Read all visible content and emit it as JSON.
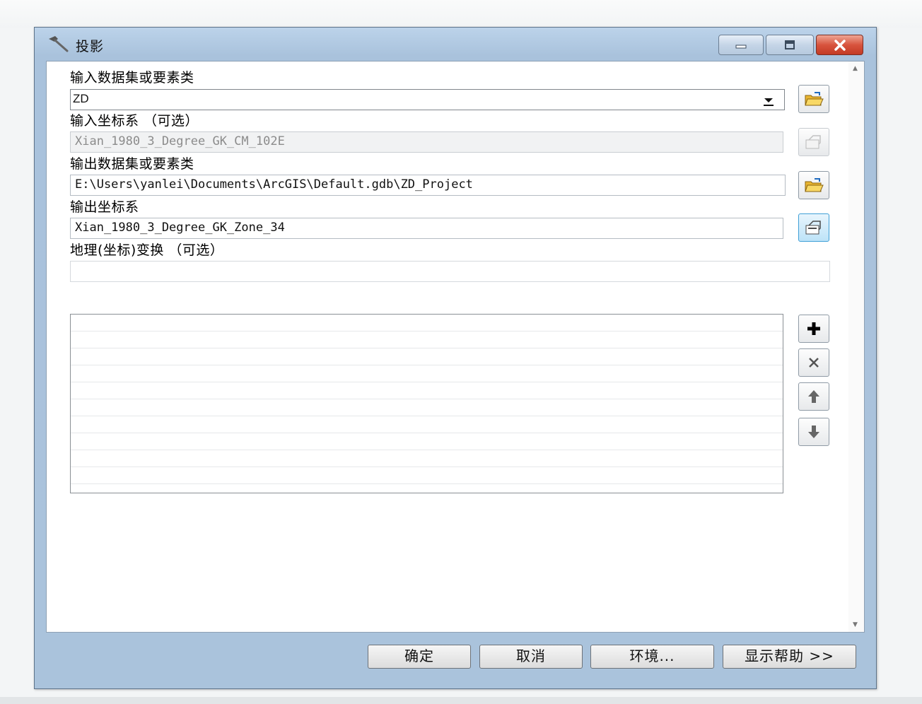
{
  "window": {
    "title": "投影",
    "icon": "hammer-icon",
    "controls": [
      "minimize-icon",
      "maximize-icon",
      "close-icon"
    ]
  },
  "form": {
    "input_dataset": {
      "label": "输入数据集或要素类",
      "value": "ZD"
    },
    "input_coord_system": {
      "label": "输入坐标系 （可选）",
      "value": "Xian_1980_3_Degree_GK_CM_102E"
    },
    "output_dataset": {
      "label": "输出数据集或要素类",
      "value": "E:\\Users\\yanlei\\Documents\\ArcGIS\\Default.gdb\\ZD_Project"
    },
    "output_coord_system": {
      "label": "输出坐标系",
      "value": "Xian_1980_3_Degree_GK_Zone_34"
    },
    "geo_transform": {
      "label": "地理(坐标)变换 （可选）",
      "value": ""
    }
  },
  "list_controls": [
    "add-icon",
    "remove-icon",
    "move-up-icon",
    "move-down-icon"
  ],
  "buttons": {
    "ok": "确定",
    "cancel": "取消",
    "environments": "环境...",
    "show_help": "显示帮助 >>"
  },
  "colors": {
    "title_bar": "#aac3dc",
    "close_button": "#c33a24",
    "active_button": "#bde3f8"
  }
}
